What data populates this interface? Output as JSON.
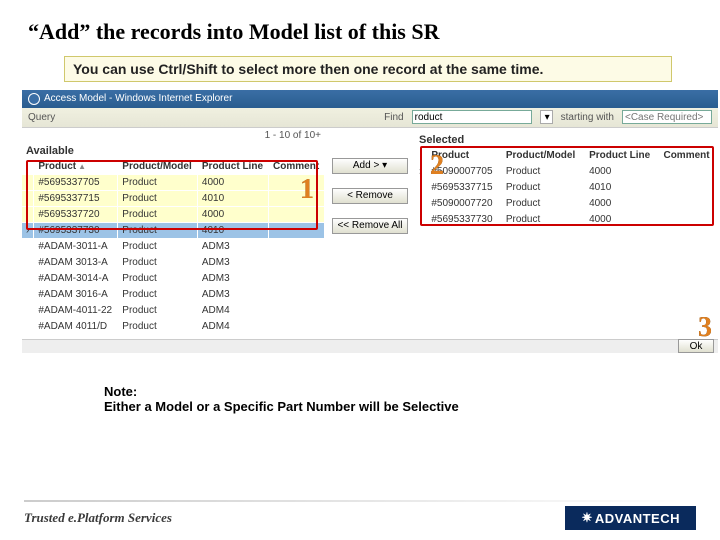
{
  "title": "“Add” the records into Model list of this SR",
  "tip": "You can use Ctrl/Shift to select more then one record at the same time.",
  "ie_title": "Access Model - Windows Internet Explorer",
  "toolbar": {
    "query": "Query",
    "find": "Find",
    "find_value": "roduct",
    "mode": "starting with",
    "hint": "<Case Required>"
  },
  "counter": "1 - 10 of 10+",
  "avail_title": "Available",
  "sel_title": "Selected",
  "cols": {
    "c1": "Product",
    "c2": "Product/Model",
    "c3": "Product Line",
    "c4": "Comment"
  },
  "avail": [
    {
      "p": "#5695337705",
      "pm": "Product",
      "pl": "4000",
      "c": ""
    },
    {
      "p": "#5695337715",
      "pm": "Product",
      "pl": "4010",
      "c": ""
    },
    {
      "p": "#5695337720",
      "pm": "Product",
      "pl": "4000",
      "c": ""
    },
    {
      "p": "#5695337730",
      "pm": "Product",
      "pl": "4010",
      "c": ""
    },
    {
      "p": "#ADAM-3011-A",
      "pm": "Product",
      "pl": "ADM3",
      "c": ""
    },
    {
      "p": "#ADAM 3013-A",
      "pm": "Product",
      "pl": "ADM3",
      "c": ""
    },
    {
      "p": "#ADAM-3014-A",
      "pm": "Product",
      "pl": "ADM3",
      "c": ""
    },
    {
      "p": "#ADAM 3016-A",
      "pm": "Product",
      "pl": "ADM3",
      "c": ""
    },
    {
      "p": "#ADAM-4011-22",
      "pm": "Product",
      "pl": "ADM4",
      "c": ""
    },
    {
      "p": "#ADAM 4011/D",
      "pm": "Product",
      "pl": "ADM4",
      "c": ""
    }
  ],
  "selrows": [
    {
      "p": "#5090007705",
      "pm": "Product",
      "pl": "4000",
      "c": ""
    },
    {
      "p": "#5695337715",
      "pm": "Product",
      "pl": "4010",
      "c": ""
    },
    {
      "p": "#5090007720",
      "pm": "Product",
      "pl": "4000",
      "c": ""
    },
    {
      "p": "#5695337730",
      "pm": "Product",
      "pl": "4000",
      "c": ""
    }
  ],
  "btns": {
    "add": "Add >",
    "remove": "< Remove",
    "removeAll": "<< Remove All"
  },
  "ok": "Ok",
  "num1": "1",
  "num2": "2",
  "num3": "3",
  "note1": "Note:",
  "note2": "Either a Model or a Specific Part Number will be Selective",
  "footer_text": "Trusted e.Platform Services",
  "brand": "ADVANTECH"
}
